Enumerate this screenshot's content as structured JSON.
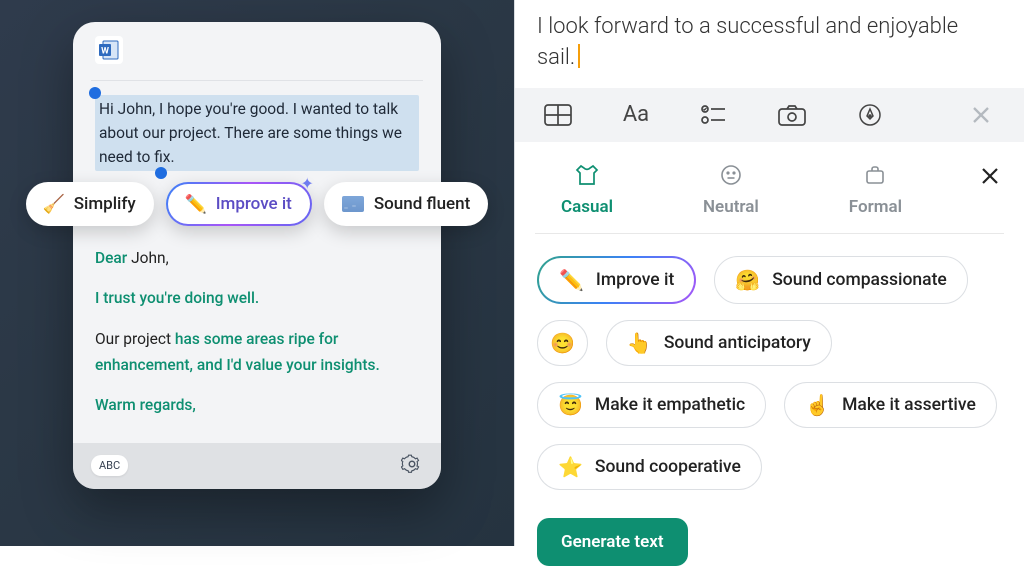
{
  "left": {
    "selected_text": "Hi John, I hope you're good. I wanted to talk about our project. There are some things we need to fix.",
    "chips": {
      "simplify": "Simplify",
      "improve": "Improve it",
      "fluent": "Sound fluent"
    },
    "rewrite": {
      "salutation_prefix": "Dear ",
      "salutation_name": "John,",
      "line1": "I trust you're doing well.",
      "line2_plain": "Our project ",
      "line2_green": "has some areas ripe for enhancement, and I'd value your insights.",
      "signoff": "Warm regards,"
    },
    "footer": {
      "abc": "ABC"
    }
  },
  "right": {
    "document_line1": "I look forward to a successful and enjoyable",
    "document_line2": "sail.",
    "toolbar_font": "Aa",
    "tabs": {
      "casual": "Casual",
      "neutral": "Neutral",
      "formal": "Formal"
    },
    "pills": {
      "improve": "Improve it",
      "compassionate": "Sound compassionate",
      "anticipatory": "Sound anticipatory",
      "empathetic": "Make it empathetic",
      "assertive": "Make it assertive",
      "cooperative": "Sound cooperative"
    },
    "generate": "Generate text"
  }
}
